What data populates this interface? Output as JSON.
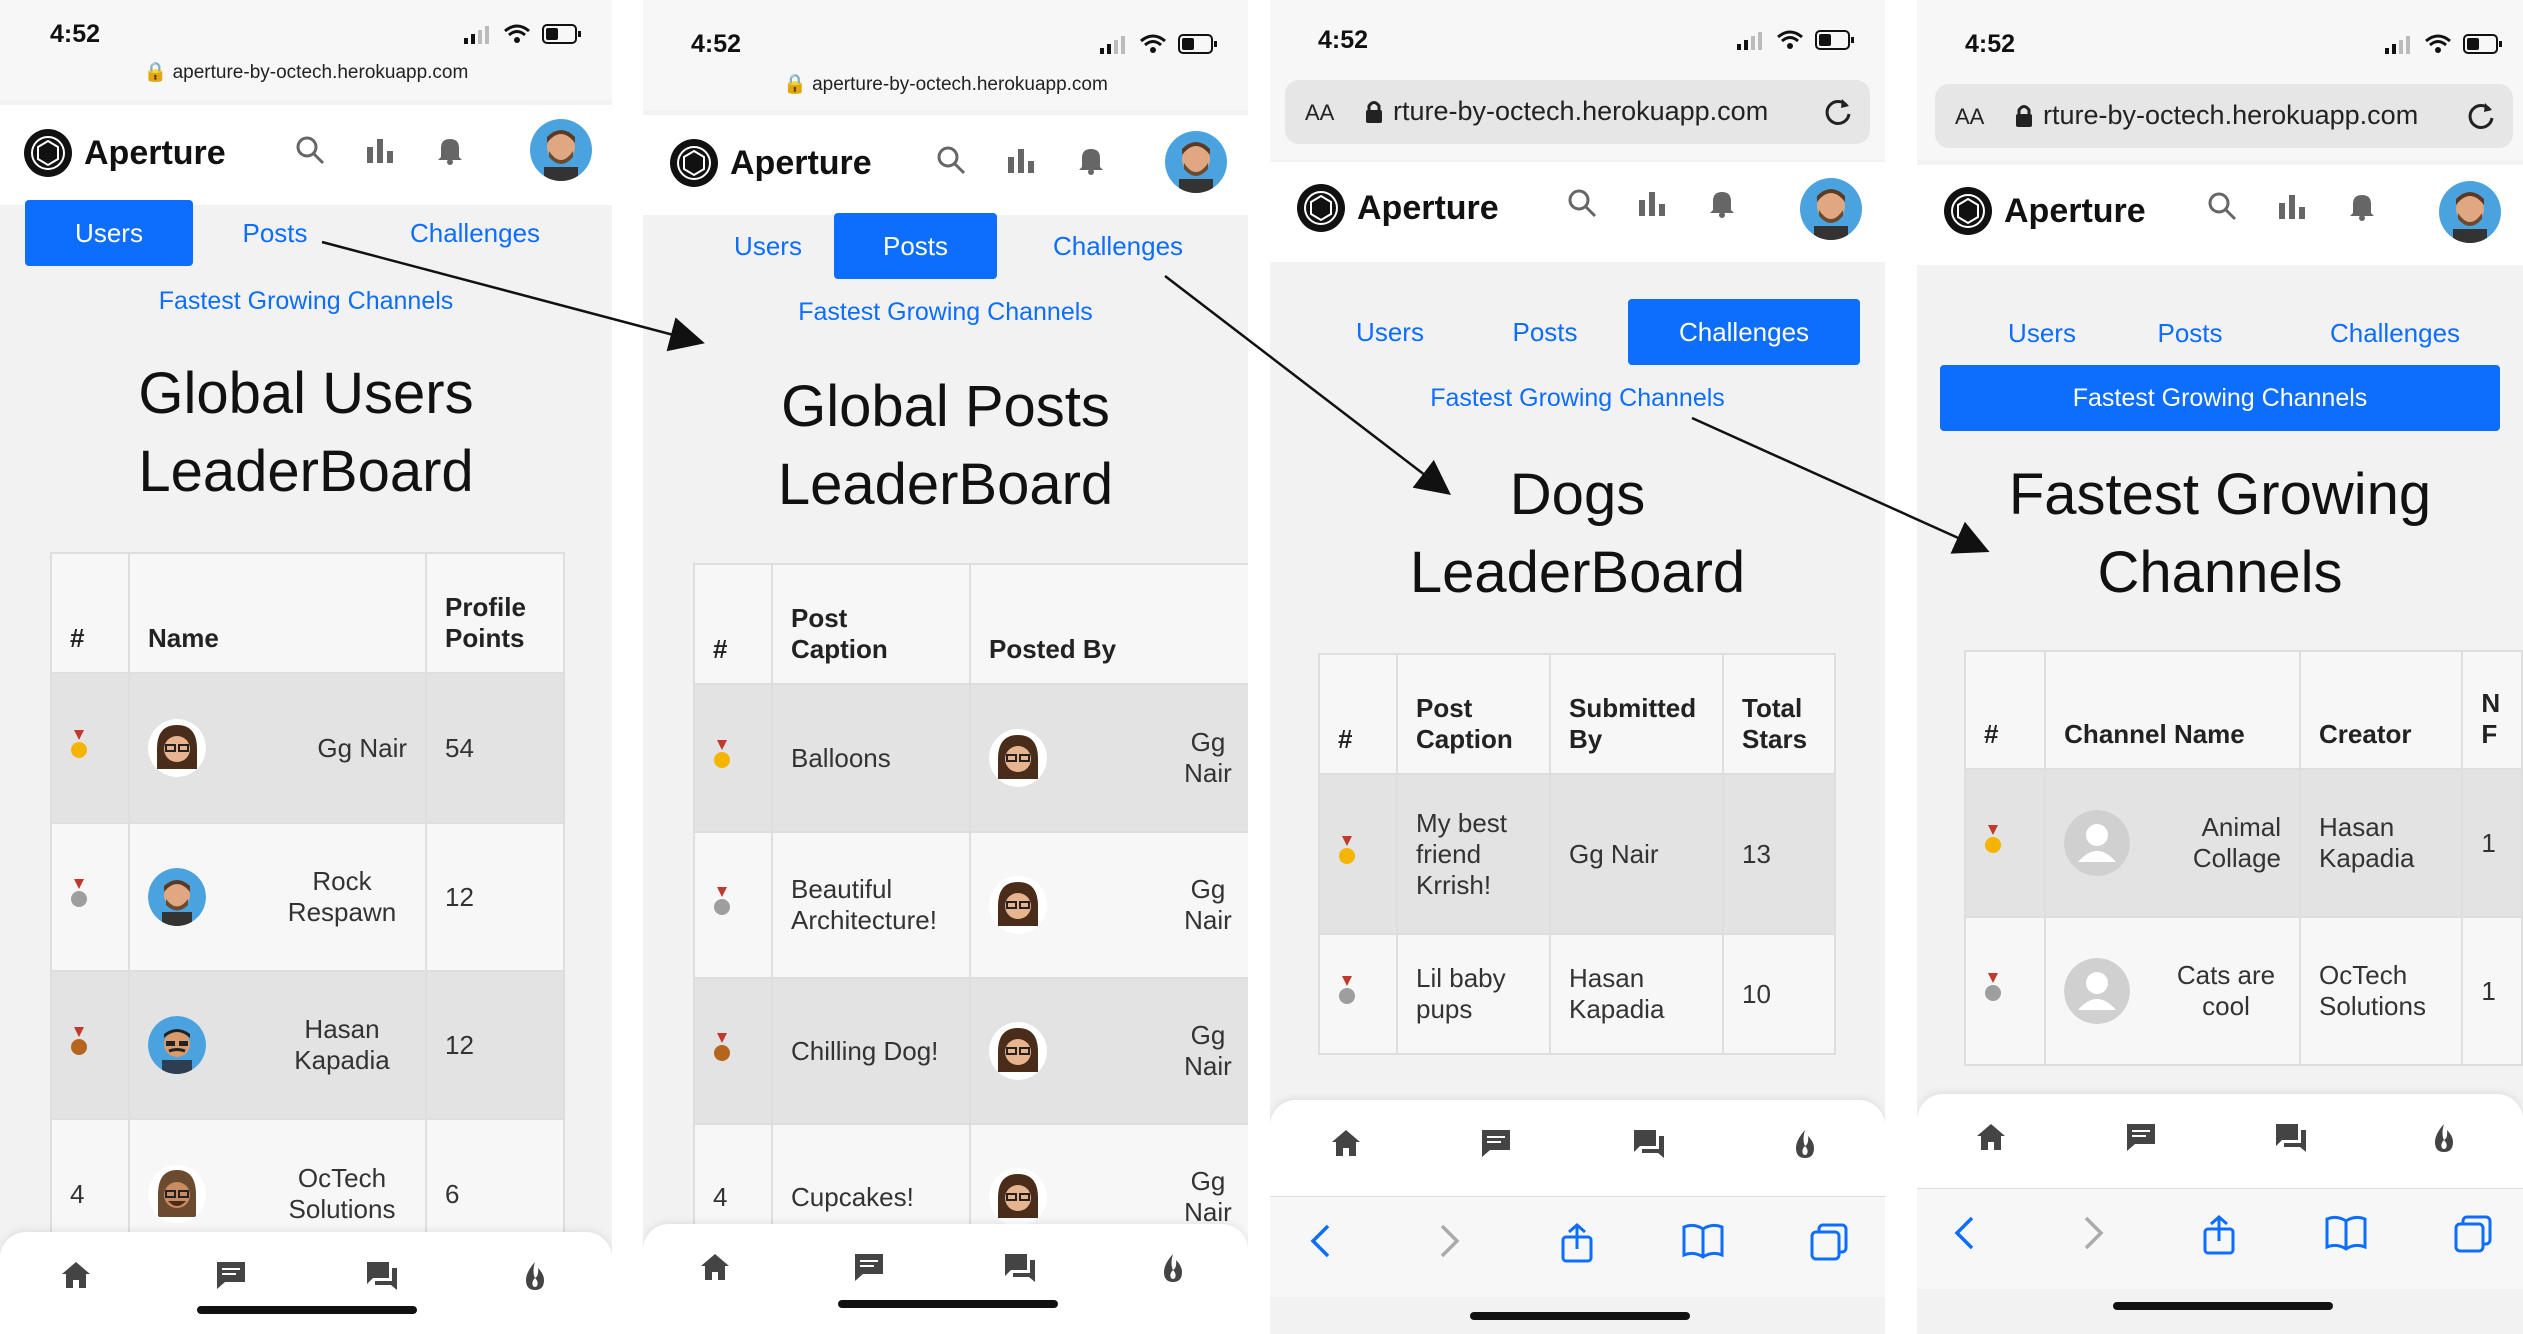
{
  "status": {
    "time": "4:52"
  },
  "browser": {
    "url_short": "aperture-by-octech.herokuapp.com",
    "url_trunc": "rture-by-octech.herokuapp.com",
    "aa": "AA"
  },
  "app": {
    "name": "Aperture"
  },
  "tabs": {
    "users": "Users",
    "posts": "Posts",
    "challenges": "Challenges",
    "fastest": "Fastest Growing Channels"
  },
  "screens": [
    {
      "title_line1": "Global Users",
      "title_line2": "LeaderBoard",
      "headers": [
        "#",
        "Name",
        "Profile Points"
      ],
      "rows": [
        {
          "rank": "gold",
          "name": "Gg Nair",
          "points": "54"
        },
        {
          "rank": "silver",
          "name": "Rock Respawn",
          "points": "12"
        },
        {
          "rank": "bronze",
          "name": "Hasan Kapadia",
          "points": "12"
        },
        {
          "rank": "4",
          "name": "OcTech Solutions",
          "points": "6"
        }
      ]
    },
    {
      "title_line1": "Global Posts",
      "title_line2": "LeaderBoard",
      "headers": [
        "#",
        "Post Caption",
        "Posted By"
      ],
      "rows": [
        {
          "rank": "gold",
          "caption": "Balloons",
          "by": "Gg Nair"
        },
        {
          "rank": "silver",
          "caption": "Beautiful Architecture!",
          "by": "Gg Nair"
        },
        {
          "rank": "bronze",
          "caption": "Chilling Dog!",
          "by": "Gg Nair"
        },
        {
          "rank": "4",
          "caption": "Cupcakes!",
          "by": "Gg Nair"
        }
      ]
    },
    {
      "title_line1": "Dogs",
      "title_line2": "LeaderBoard",
      "headers": [
        "#",
        "Post Caption",
        "Submitted By",
        "Total Stars"
      ],
      "rows": [
        {
          "rank": "gold",
          "caption": "My best friend Krrish!",
          "by": "Gg Nair",
          "stars": "13"
        },
        {
          "rank": "silver",
          "caption": "Lil baby pups",
          "by": "Hasan Kapadia",
          "stars": "10"
        }
      ]
    },
    {
      "title_line1": "Fastest Growing",
      "title_line2": "Channels",
      "headers": [
        "#",
        "Channel Name",
        "Creator",
        "N F"
      ],
      "rows": [
        {
          "rank": "gold",
          "channel": "Animal Collage",
          "creator": "Hasan Kapadia",
          "n": "1"
        },
        {
          "rank": "silver",
          "channel": "Cats are cool",
          "creator": "OcTech Solutions",
          "n": "1"
        }
      ]
    }
  ],
  "colors": {
    "primary": "#0d6efd",
    "gold": "#f4b400",
    "silver": "#9e9e9e",
    "bronze": "#b5651d"
  },
  "icons": [
    "search-icon",
    "bar-chart-icon",
    "bell-icon",
    "home-icon",
    "comment-icon",
    "chat-icon",
    "flame-icon",
    "back-icon",
    "forward-icon",
    "share-icon",
    "book-icon",
    "tabs-icon",
    "lock-icon",
    "reload-icon",
    "wifi-icon",
    "signal-icon",
    "battery-icon"
  ]
}
